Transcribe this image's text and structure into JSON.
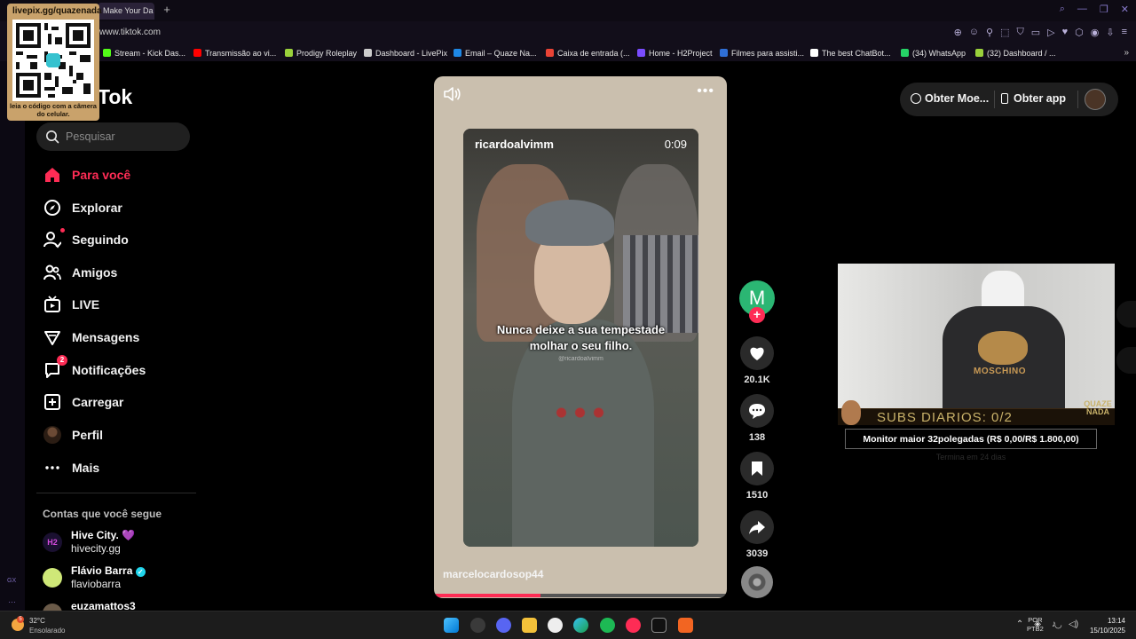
{
  "browser": {
    "tab_title": "Make Your Da",
    "new_tab_symbol": "+",
    "url": "www.tiktok.com",
    "bookmarks": [
      {
        "label": "Stream - Kick Das...",
        "color": "#53fc18"
      },
      {
        "label": "Transmissão ao vi...",
        "color": "#ff0000"
      },
      {
        "label": "Prodigy Roleplay",
        "color": "#9ad13b"
      },
      {
        "label": "Dashboard - LivePix",
        "color": "#cccccc"
      },
      {
        "label": "Email – Quaze Na...",
        "color": "#1e88e5"
      },
      {
        "label": "Caixa de entrada (...",
        "color": "#ea4335"
      },
      {
        "label": "Home - H2Project",
        "color": "#7a4cff"
      },
      {
        "label": "Filmes para assisti...",
        "color": "#2f6fd6"
      },
      {
        "label": "The best ChatBot...",
        "color": "#ffffff"
      },
      {
        "label": "(34) WhatsApp",
        "color": "#25d366"
      },
      {
        "label": "(32) Dashboard / ...",
        "color": "#9ad13b"
      }
    ],
    "more_bookmarks": "»"
  },
  "qr_overlay": {
    "title": "livepix.gg/quazenada",
    "caption": "leia o código com a câmera do celular."
  },
  "tiktok": {
    "logo_text": "Tok",
    "search_placeholder": "Pesquisar",
    "nav": [
      {
        "label": "Para você",
        "icon": "home-icon",
        "active": true
      },
      {
        "label": "Explorar",
        "icon": "compass-icon"
      },
      {
        "label": "Seguindo",
        "icon": "following-icon"
      },
      {
        "label": "Amigos",
        "icon": "friends-icon"
      },
      {
        "label": "LIVE",
        "icon": "live-icon"
      },
      {
        "label": "Mensagens",
        "icon": "messages-icon"
      },
      {
        "label": "Notificações",
        "icon": "notifications-icon",
        "badge": "2"
      },
      {
        "label": "Carregar",
        "icon": "upload-icon"
      },
      {
        "label": "Perfil",
        "icon": "profile-avatar"
      },
      {
        "label": "Mais",
        "icon": "more-icon"
      }
    ],
    "following_title": "Contas que você segue",
    "following": [
      {
        "name": "Hive City. 💜",
        "handle": "hivecity.gg"
      },
      {
        "name": "Flávio Barra",
        "handle": "flaviobarra"
      },
      {
        "name": "euzamattos3",
        "handle": ""
      }
    ]
  },
  "video": {
    "overlay_user": "ricardoalvimm",
    "time": "0:09",
    "caption_line1": "Nunca deixe a sua tempestade",
    "caption_line2": "molhar o seu filho.",
    "watermark": "@ricardoalvimm",
    "author": "marcelocardosop44",
    "progress": 0.365,
    "more_symbol": "•••"
  },
  "actions": {
    "creator_initial": "M",
    "follow_symbol": "+",
    "likes": "20.1K",
    "comments": "138",
    "saves": "1510",
    "shares": "3039"
  },
  "top_right": {
    "coins_label": "Obter Moe...",
    "app_label": "Obter app"
  },
  "stream_overlay": {
    "brand": "MOSCHINO",
    "subs_text": "SUBS DIARIOS: 0/2",
    "logo_text": "QUAZE NADA",
    "goal_text": "Monitor maior 32polegadas (R$ 0,00/R$ 1.800,00)",
    "goal_sub": "Termina em 24 dias"
  },
  "taskbar": {
    "temperature": "32°C",
    "weather": "Ensolarado",
    "weather_badge": "5",
    "lang_line1": "POR",
    "lang_line2": "PTB2",
    "time": "13:14",
    "date": "15/10/2025"
  }
}
